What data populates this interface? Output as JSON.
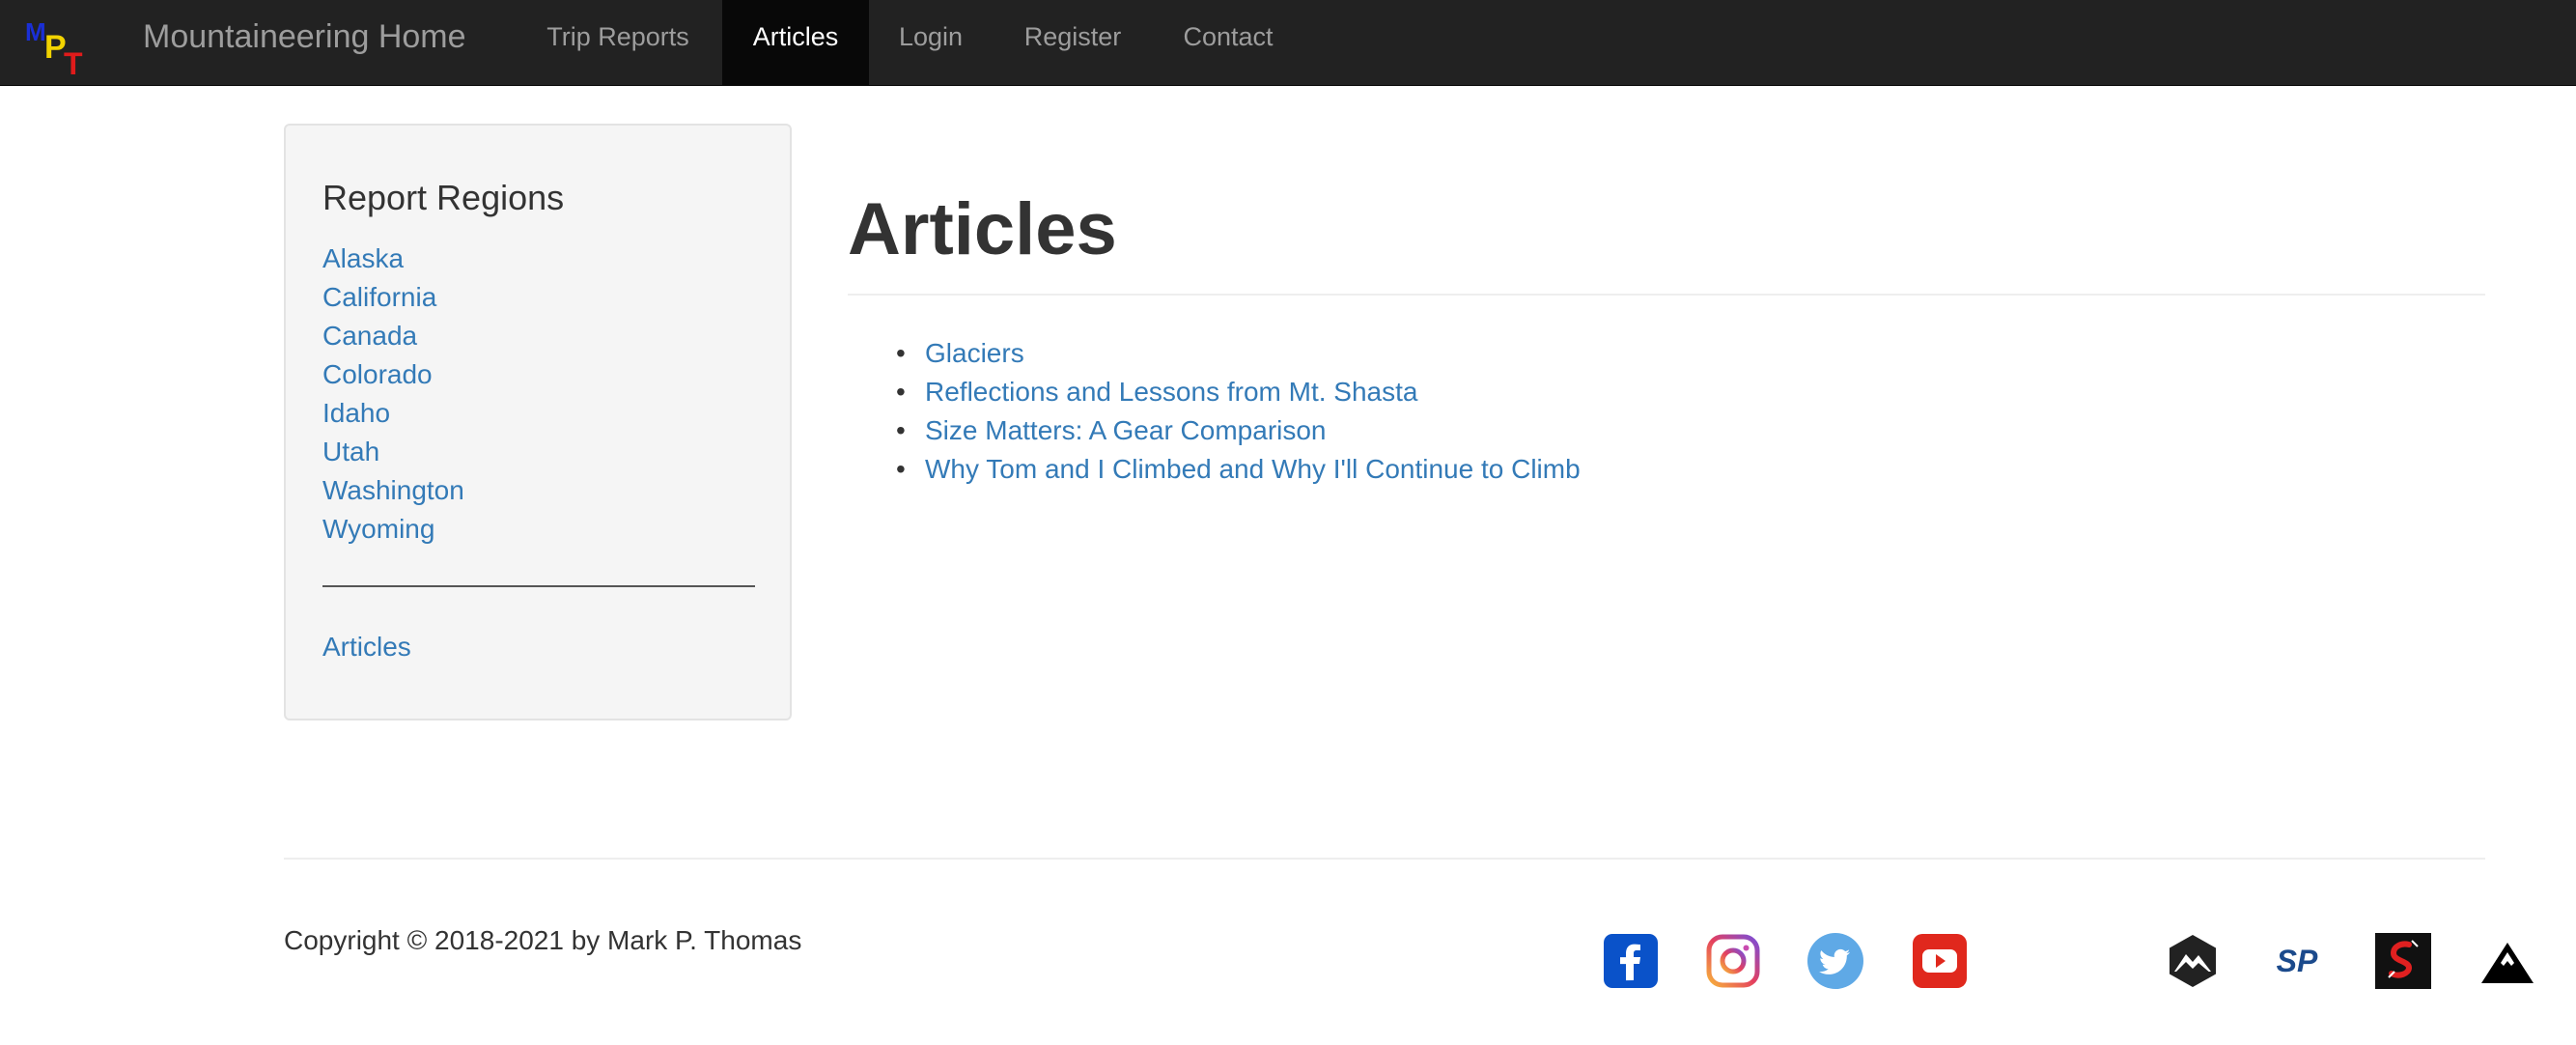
{
  "navbar": {
    "logo_letters": {
      "m": "M",
      "p": "P",
      "t": "T"
    },
    "brand": "Mountaineering Home",
    "items": [
      {
        "label": "Trip Reports"
      },
      {
        "label": "Articles",
        "active": true
      },
      {
        "label": "Login"
      },
      {
        "label": "Register"
      },
      {
        "label": "Contact"
      }
    ]
  },
  "sidebar": {
    "heading": "Report Regions",
    "regions": [
      "Alaska",
      "California",
      "Canada",
      "Colorado",
      "Idaho",
      "Utah",
      "Washington",
      "Wyoming"
    ],
    "articles_link": "Articles"
  },
  "main": {
    "title": "Articles",
    "articles": [
      "Glaciers",
      "Reflections and Lessons from Mt. Shasta",
      "Size Matters: A Gear Comparison",
      "Why Tom and I Climbed and Why I'll Continue to Climb"
    ]
  },
  "footer": {
    "copyright": "Copyright © 2018-2021 by Mark P. Thomas",
    "social_icons": [
      "facebook-icon",
      "instagram-icon",
      "twitter-icon",
      "youtube-icon"
    ],
    "site_icons": [
      "peakbagger-icon",
      "summitpost-icon",
      "strava-icon",
      "mountain-project-icon"
    ]
  },
  "colors": {
    "navbar_bg": "#222222",
    "active_nav_bg": "#080808",
    "link": "#337ab7",
    "text": "#333333",
    "sidebar_bg": "#f5f5f5",
    "logo_m": "#1a2fd6",
    "logo_p": "#f2d300",
    "logo_t": "#e01b1b",
    "facebook": "#0a52c9",
    "twitter": "#5fa9e6",
    "youtube": "#e0281d"
  }
}
